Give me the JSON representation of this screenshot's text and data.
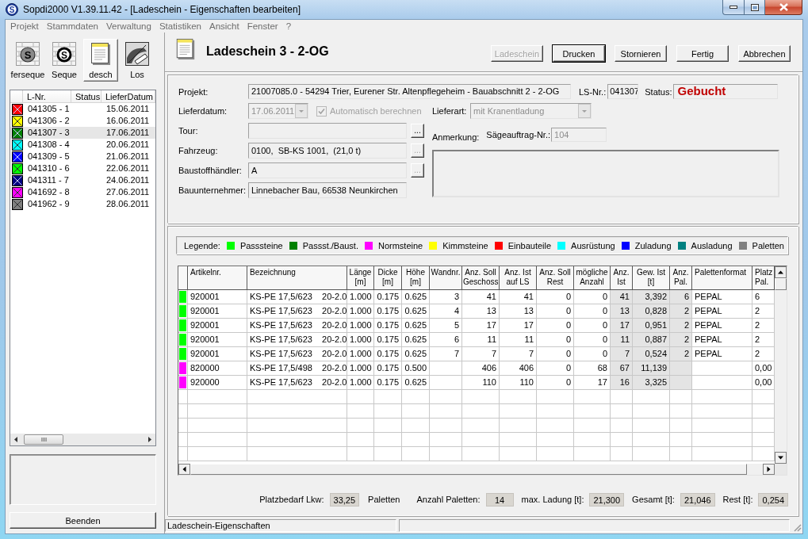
{
  "window": {
    "title": "Sopdi2000 V1.39.11.42 - [Ladeschein - Eigenschaften bearbeiten]",
    "icon_letter": "S"
  },
  "menu": [
    "Projekt",
    "Stammdaten",
    "Verwaltung",
    "Statistiken",
    "Ansicht",
    "Fenster",
    "?"
  ],
  "toolbar": [
    {
      "label": "ferseque",
      "kind": "wall",
      "letter": "S",
      "selected": false
    },
    {
      "label": "Seque",
      "kind": "wallring",
      "letter": "S",
      "selected": false
    },
    {
      "label": "desch",
      "kind": "notepad",
      "selected": true
    },
    {
      "label": "Los",
      "kind": "picture",
      "selected": false
    }
  ],
  "delivery_list": {
    "columns": [
      "L-Nr.",
      "Status",
      "LieferDatum"
    ],
    "rows": [
      {
        "number": "041305 - 1",
        "date": "15.06.2011",
        "color": "#ff0000",
        "selected": false
      },
      {
        "number": "041306 - 2",
        "date": "16.06.2011",
        "color": "#ffff00",
        "selected": false
      },
      {
        "number": "041307 - 3",
        "date": "17.06.2011",
        "color": "#008000",
        "selected": true
      },
      {
        "number": "041308 - 4",
        "date": "20.06.2011",
        "color": "#00ffff",
        "selected": false
      },
      {
        "number": "041309 - 5",
        "date": "21.06.2011",
        "color": "#0000ff",
        "selected": false
      },
      {
        "number": "041310 - 6",
        "date": "22.06.2011",
        "color": "#00ff00",
        "selected": false
      },
      {
        "number": "041311 - 7",
        "date": "24.06.2011",
        "color": "#000080",
        "selected": false
      },
      {
        "number": "041692 - 8",
        "date": "27.06.2011",
        "color": "#ff00ff",
        "selected": false
      },
      {
        "number": "041962 - 9",
        "date": "28.06.2011",
        "color": "#808080",
        "selected": false
      }
    ]
  },
  "exit_button": "Beenden",
  "document": {
    "title": "Ladeschein 3 - 2-OG",
    "buttons": [
      {
        "label": "Ladeschein",
        "disabled": true,
        "default": false
      },
      {
        "label": "Drucken",
        "disabled": false,
        "default": true
      },
      {
        "label": "Stornieren",
        "disabled": false,
        "default": false
      },
      {
        "label": "Fertig",
        "disabled": false,
        "default": false
      },
      {
        "label": "Abbrechen",
        "disabled": false,
        "default": false
      }
    ]
  },
  "form": {
    "project": {
      "label": "Projekt:",
      "value": "21007085.0 - 54294 Trier, Eurener Str. Altenpflegeheim - Bauabschnitt 2 - 2-OG"
    },
    "ls_number": {
      "label": "LS-Nr.:",
      "value": "041307"
    },
    "status": {
      "label": "Status:",
      "value": "Gebucht"
    },
    "delivery_date": {
      "label": "Lieferdatum:",
      "value": "17.06.2011",
      "disabled": true
    },
    "auto_calculate": {
      "label": "Automatisch berechnen",
      "checked": true,
      "disabled": true
    },
    "delivery_type": {
      "label": "Lieferart:",
      "value": "mit Kranentladung",
      "disabled": true
    },
    "tour": {
      "label": "Tour:",
      "button": {
        "label": "...",
        "disabled": false
      }
    },
    "vehicle": {
      "label": "Fahrzeug:",
      "value": "0100,  SB-KS 1001,  (21,0 t)",
      "button": {
        "label": "...",
        "disabled": true
      }
    },
    "dealer": {
      "label": "Baustoffhändler:",
      "value": "A",
      "button": {
        "label": "...",
        "disabled": true
      }
    },
    "contractor": {
      "label": "Bauunternehmer:",
      "value": "Linnebacher Bau, 66538 Neunkirchen"
    },
    "remark": {
      "label": "Anmerkung:"
    },
    "saw_order": {
      "label": "Sägeauftrag-Nr.:",
      "value": "104",
      "disabled": true
    }
  },
  "legend": {
    "label": "Legende:",
    "items": [
      {
        "label": "Passsteine",
        "color": "#00ff00"
      },
      {
        "label": "Passst./Baust.",
        "color": "#008000"
      },
      {
        "label": "Normsteine",
        "color": "#ff00ff"
      },
      {
        "label": "Kimmsteine",
        "color": "#ffff00"
      },
      {
        "label": "Einbauteile",
        "color": "#ff0000"
      },
      {
        "label": "Ausrüstung",
        "color": "#00ffff"
      },
      {
        "label": "Zuladung",
        "color": "#0000ff"
      },
      {
        "label": "Ausladung",
        "color": "#008080"
      },
      {
        "label": "Paletten",
        "color": "#808080"
      }
    ]
  },
  "table": {
    "columns": [
      {
        "label": "Artikelnr.",
        "kind": "text",
        "shaded": false
      },
      {
        "label": "Bezeichnung",
        "kind": "text",
        "shaded": false
      },
      {
        "label": "Länge\n[m]",
        "kind": "number",
        "shaded": false
      },
      {
        "label": "Dicke\n[m]",
        "kind": "number",
        "shaded": false
      },
      {
        "label": "Höhe\n[m]",
        "kind": "number",
        "shaded": false
      },
      {
        "label": "Wandnr.",
        "kind": "number",
        "shaded": false
      },
      {
        "label": "Anz. Soll\nGeschoss",
        "kind": "number",
        "shaded": false
      },
      {
        "label": "Anz. Ist\nauf LS",
        "kind": "number",
        "shaded": false
      },
      {
        "label": "Anz. Soll\nRest",
        "kind": "number",
        "shaded": false
      },
      {
        "label": "mögliche\nAnzahl",
        "kind": "number",
        "shaded": false
      },
      {
        "label": "Anz.\nIst",
        "kind": "number",
        "shaded": true
      },
      {
        "label": "Gew. Ist\n[t]",
        "kind": "number",
        "shaded": true
      },
      {
        "label": "Anz.\nPal.",
        "kind": "number",
        "shaded": true
      },
      {
        "label": "Palettenformat",
        "kind": "text",
        "shaded": false
      },
      {
        "label": "Platz\nPal.",
        "kind": "text",
        "shaded": false
      }
    ],
    "rows": [
      {
        "color": "#00ff00",
        "cells": [
          "920001",
          "KS-PE 17,5/623    20-2.0",
          "1.000",
          "0.175",
          "0.625",
          "3",
          "41",
          "41",
          "0",
          "0",
          "41",
          "3,392",
          "6",
          "PEPAL",
          "6"
        ]
      },
      {
        "color": "#00ff00",
        "cells": [
          "920001",
          "KS-PE 17,5/623    20-2.0",
          "1.000",
          "0.175",
          "0.625",
          "4",
          "13",
          "13",
          "0",
          "0",
          "13",
          "0,828",
          "2",
          "PEPAL",
          "2"
        ]
      },
      {
        "color": "#00ff00",
        "cells": [
          "920001",
          "KS-PE 17,5/623    20-2.0",
          "1.000",
          "0.175",
          "0.625",
          "5",
          "17",
          "17",
          "0",
          "0",
          "17",
          "0,951",
          "2",
          "PEPAL",
          "2"
        ]
      },
      {
        "color": "#00ff00",
        "cells": [
          "920001",
          "KS-PE 17,5/623    20-2.0",
          "1.000",
          "0.175",
          "0.625",
          "6",
          "11",
          "11",
          "0",
          "0",
          "11",
          "0,887",
          "2",
          "PEPAL",
          "2"
        ]
      },
      {
        "color": "#00ff00",
        "cells": [
          "920001",
          "KS-PE 17,5/623    20-2.0",
          "1.000",
          "0.175",
          "0.625",
          "7",
          "7",
          "7",
          "0",
          "0",
          "7",
          "0,524",
          "2",
          "PEPAL",
          "2"
        ]
      },
      {
        "color": "#ff00ff",
        "cells": [
          "820000",
          "KS-PE 17,5/498    20-2.0",
          "1.000",
          "0.175",
          "0.500",
          null,
          "406",
          "406",
          "0",
          "68",
          "67",
          "11,139",
          null,
          null,
          "0,00"
        ]
      },
      {
        "color": "#ff00ff",
        "cells": [
          "920000",
          "KS-PE 17,5/623    20-2.0",
          "1.000",
          "0.175",
          "0.625",
          null,
          "110",
          "110",
          "0",
          "17",
          "16",
          "3,325",
          null,
          null,
          "0,00"
        ]
      }
    ]
  },
  "summary": [
    {
      "label": "Platzbedarf Lkw:",
      "value": "33,25",
      "unit": "Paletten"
    },
    {
      "label": "Anzahl Paletten:",
      "value": "14"
    },
    {
      "label": "max. Ladung [t]:",
      "value": "21,300"
    },
    {
      "label": "Gesamt [t]:",
      "value": "21,046"
    },
    {
      "label": "Rest [t]:",
      "value": "0,254"
    }
  ],
  "status_bar": {
    "text": "Ladeschein-Eigenschaften"
  }
}
